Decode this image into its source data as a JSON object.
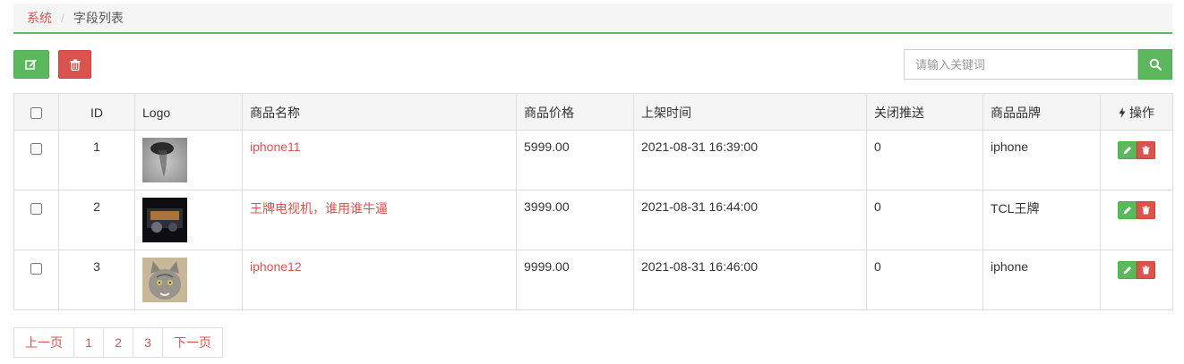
{
  "breadcrumb": {
    "parent": "系统",
    "separator": "/",
    "current": "字段列表"
  },
  "toolbar": {
    "edit_icon": "edit-icon",
    "delete_icon": "trash-icon"
  },
  "search": {
    "placeholder": "请输入关键词",
    "value": "",
    "button_icon": "search-icon"
  },
  "table": {
    "headers": {
      "select": "",
      "id": "ID",
      "logo": "Logo",
      "name": "商品名称",
      "price": "商品价格",
      "time": "上架时间",
      "push": "关闭推送",
      "brand": "商品品牌",
      "ops": "操作"
    },
    "rows": [
      {
        "id": "1",
        "logo": "product-thumbnail-dark",
        "name": "iphone11",
        "price": "5999.00",
        "time": "2021-08-31 16:39:00",
        "push": "0",
        "brand": "iphone"
      },
      {
        "id": "2",
        "logo": "product-thumbnail-tv",
        "name": "王牌电视机，谁用谁牛逼",
        "price": "3999.00",
        "time": "2021-08-31 16:44:00",
        "push": "0",
        "brand": "TCL王牌"
      },
      {
        "id": "3",
        "logo": "product-thumbnail-cat",
        "name": "iphone12",
        "price": "9999.00",
        "time": "2021-08-31 16:46:00",
        "push": "0",
        "brand": "iphone"
      }
    ]
  },
  "pagination": {
    "prev": "上一页",
    "pages": [
      "1",
      "2",
      "3"
    ],
    "next": "下一页"
  },
  "colors": {
    "success": "#5cb85c",
    "danger": "#d9534f",
    "header_bg": "#f5f5f5",
    "border": "#dddddd"
  }
}
